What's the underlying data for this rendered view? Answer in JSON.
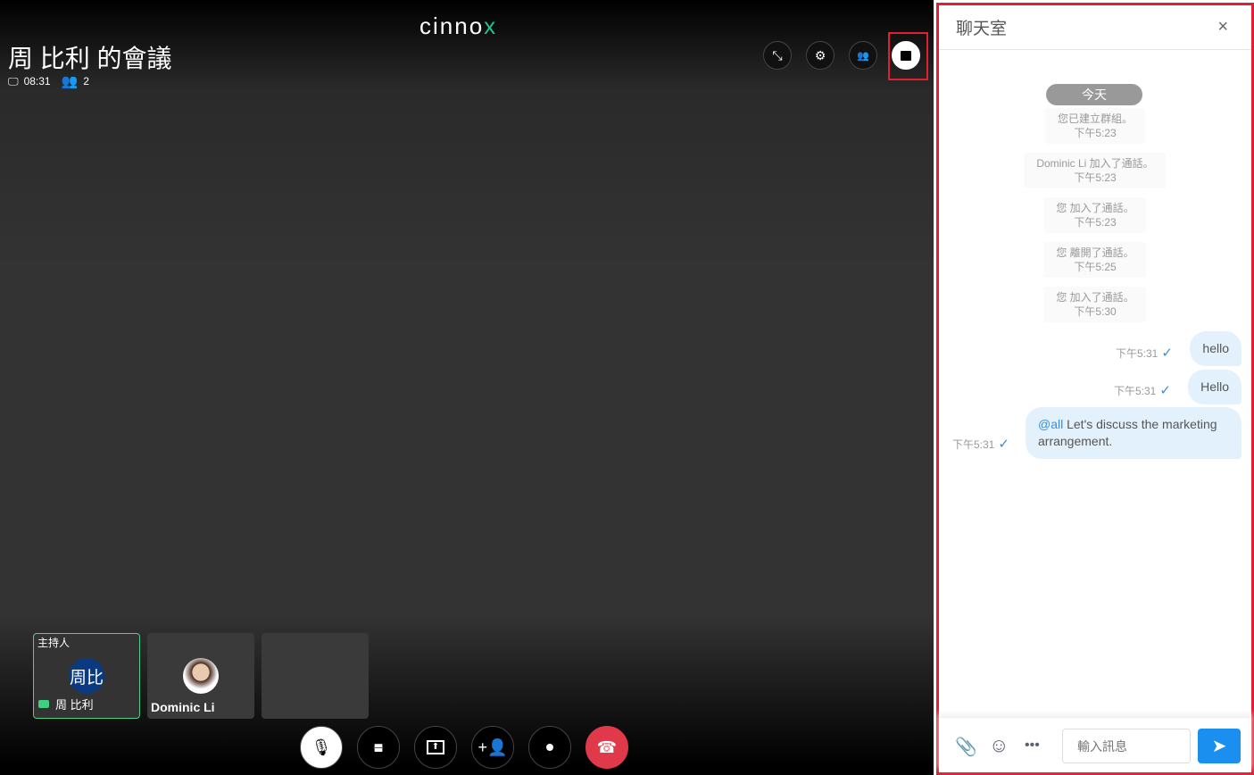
{
  "logo": {
    "text": "cinno",
    "accent": "x"
  },
  "meeting": {
    "title": "周 比利 的會議",
    "duration": "08:31",
    "participants": "2"
  },
  "participants": [
    {
      "role": "主持人",
      "avatar_text": "周比",
      "name": "周 比利"
    },
    {
      "name": "Dominic Li"
    }
  ],
  "chat": {
    "title": "聊天室",
    "close": "×",
    "date_label": "今天",
    "system_messages": [
      {
        "text": "您已建立群組。",
        "time": "下午5:23"
      },
      {
        "text": "Dominic Li 加入了通話。",
        "time": "下午5:23"
      },
      {
        "text": "您 加入了通話。",
        "time": "下午5:23"
      },
      {
        "text": "您 離開了通話。",
        "time": "下午5:25"
      },
      {
        "text": "您 加入了通話。",
        "time": "下午5:30"
      }
    ],
    "messages": [
      {
        "text": "hello",
        "time": "下午5:31"
      },
      {
        "text": "Hello",
        "time": "下午5:31"
      },
      {
        "mention": "@all",
        "text": " Let's discuss the marketing arrangement.",
        "time": "下午5:31"
      }
    ],
    "read_mark": "✓",
    "input_placeholder": "輸入訊息"
  },
  "colors": {
    "accent": "#1a8ff0",
    "highlight": "#e02030",
    "end_call": "#e0394a"
  }
}
